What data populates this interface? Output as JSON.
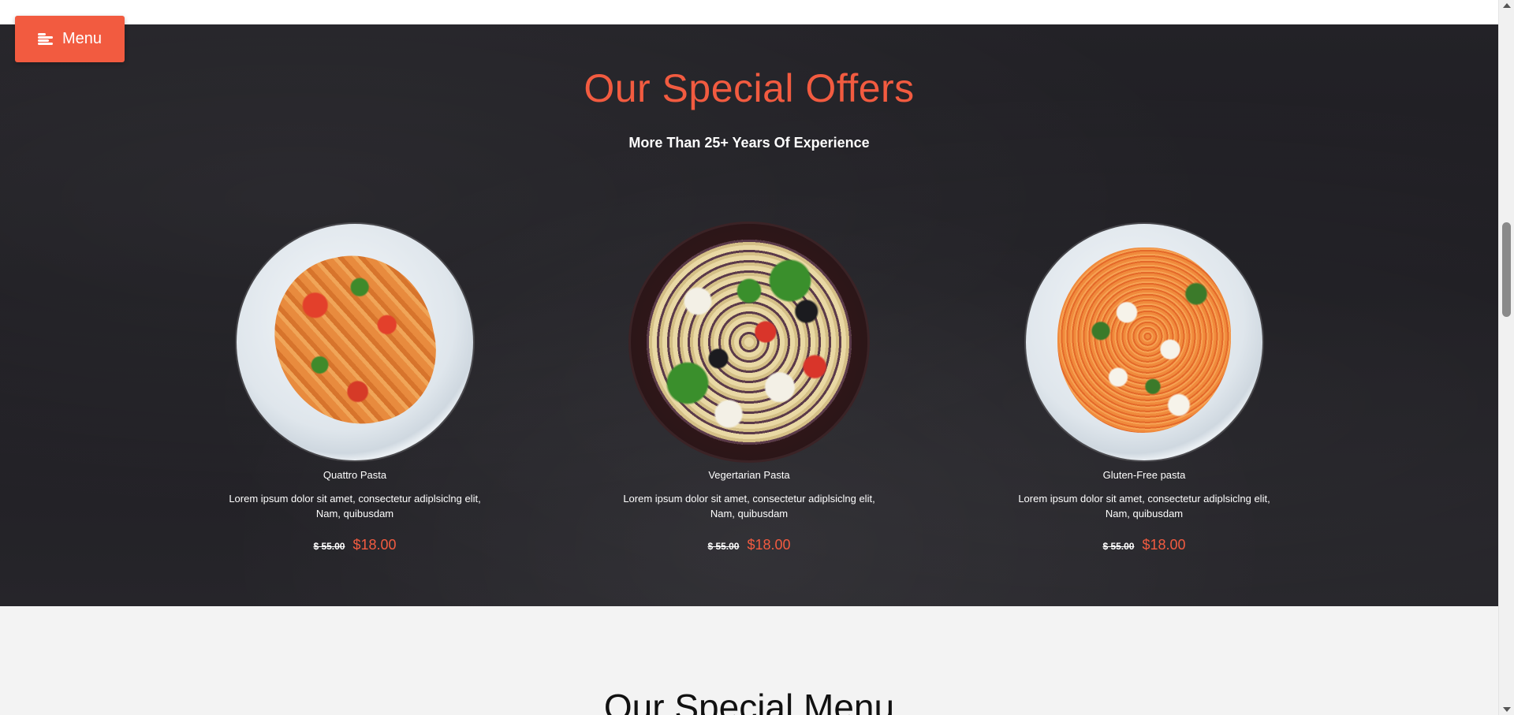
{
  "menu_button": {
    "label": "Menu",
    "icon": "menu-lines-icon"
  },
  "offers": {
    "title": "Our Special Offers",
    "subtitle": "More Than 25+ Years Of Experience",
    "items": [
      {
        "name": "Quattro Pasta",
        "description": "Lorem ipsum dolor sit amet, consectetur adiplsiclng elit, Nam, quibusdam",
        "old_price": "$ 55.00",
        "new_price": "$18.00",
        "image": "penne-pasta-plate"
      },
      {
        "name": "Vegertarian Pasta",
        "description": "Lorem ipsum dolor sit amet, consectetur adiplsiclng elit, Nam, quibusdam",
        "old_price": "$ 55.00",
        "new_price": "$18.00",
        "image": "pasta-salad-bowl"
      },
      {
        "name": "Gluten-Free pasta",
        "description": "Lorem ipsum dolor sit amet, consectetur adiplsiclng elit, Nam, quibusdam",
        "old_price": "$ 55.00",
        "new_price": "$18.00",
        "image": "spaghetti-plate"
      }
    ]
  },
  "menu_section": {
    "title": "Our Special Menu"
  },
  "colors": {
    "accent": "#f25b40",
    "dark_bg": "#222126",
    "light_bg": "#f3f3f3"
  }
}
